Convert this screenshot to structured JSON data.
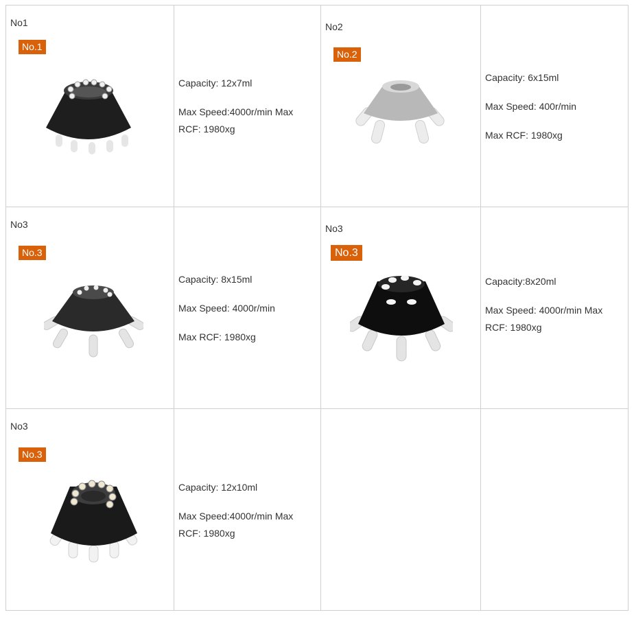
{
  "rows": [
    {
      "left": {
        "heading": "No1",
        "badge": "No.1",
        "specs": [
          "Capacity: 12x7ml",
          "Max Speed:4000r/min Max RCF: 1980xg"
        ]
      },
      "right": {
        "heading": "No2",
        "badge": "No.2",
        "specs": [
          "Capacity: 6x15ml",
          "Max Speed: 400r/min",
          "Max RCF: 1980xg"
        ]
      }
    },
    {
      "left": {
        "heading": "No3",
        "badge": "No.3",
        "specs": [
          "Capacity: 8x15ml",
          "Max Speed: 4000r/min",
          "Max RCF: 1980xg"
        ]
      },
      "right": {
        "heading": "No3",
        "badge": "No.3",
        "specs": [
          "Capacity:8x20ml",
          "Max Speed: 4000r/min Max RCF: 1980xg"
        ]
      }
    },
    {
      "left": {
        "heading": "No3",
        "badge": "No.3",
        "specs": [
          "Capacity: 12x10ml",
          "Max Speed:4000r/min Max RCF: 1980xg"
        ]
      }
    }
  ],
  "colors": {
    "badge": "#d9610a",
    "border": "#cfcfcf",
    "rotor_dark": "#1c1c1c",
    "rotor_silver": "#bdbdbd",
    "tube": "#e8e8e8"
  }
}
